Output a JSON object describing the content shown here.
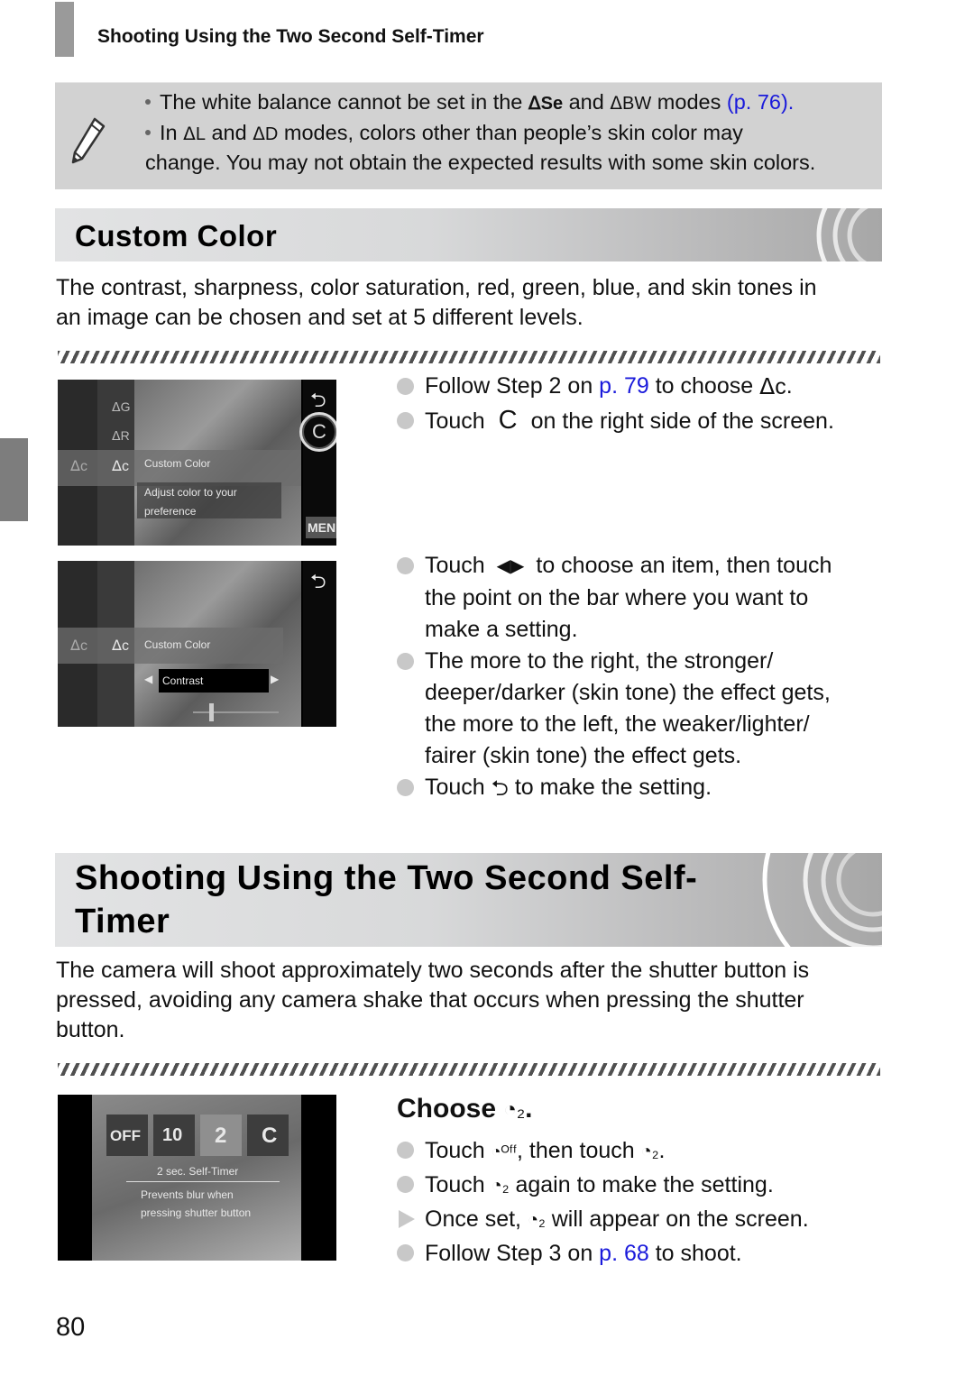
{
  "running_header": {
    "title": "Shooting Using the Two Second Self-Timer"
  },
  "note": {
    "icon": "pencil-icon",
    "line1": {
      "pre": "The white balance cannot be set in the",
      "mode1": "Se",
      "mid": "and",
      "mode2": "BW",
      "post": "modes",
      "link": "(p. 76)",
      "end": "."
    },
    "line2": {
      "pre": "In",
      "mode1": "L",
      "mid": "and",
      "mode2": "D",
      "post": "modes, colors other than people’s skin color may"
    },
    "line3": "change. You may not obtain the expected results with some skin colors."
  },
  "custom_color": {
    "heading": "Custom Color",
    "intro_line1": "The contrast, sharpness, color saturation, red, green, blue, and skin tones in",
    "intro_line2": "an image can be chosen and set at 5 different levels.",
    "screen1": {
      "label_title": "Custom Color",
      "label_desc1": "Adjust color to your",
      "label_desc2": "preference",
      "menu": "MENU",
      "button": "C"
    },
    "screen2": {
      "label_title": "Custom Color",
      "item": "Contrast"
    },
    "steps_a": [
      {
        "pre": "Follow Step 2 on",
        "link": "p. 79",
        "post": "to choose",
        "icon": "custom-color-mode-icon",
        "end": "."
      },
      {
        "pre": "Touch",
        "glyph": "C",
        "post": "on the right side of the screen."
      }
    ],
    "steps_b": [
      {
        "lines": [
          "to choose an item, then touch",
          "the point on the bar where you want to",
          "make a setting."
        ],
        "pre": "Touch"
      },
      {
        "lines": [
          "The more to the right, the stronger/",
          "deeper/darker (skin tone) the effect gets,",
          "the more to the left, the weaker/lighter/",
          "fairer (skin tone) the effect gets."
        ]
      },
      {
        "pre": "Touch",
        "post": "to make the setting."
      }
    ]
  },
  "self_timer": {
    "heading_line1": "Shooting Using the Two Second Self-",
    "heading_line2": "Timer",
    "intro_line1": "The camera will shoot approximately two seconds after the shutter button is",
    "intro_line2": "pressed, avoiding any camera shake that occurs when pressing the shutter",
    "intro_line3": "button.",
    "screen": {
      "options": [
        "OFF",
        "10",
        "2",
        "C"
      ],
      "selected": "2",
      "label_title": "2 sec. Self-Timer",
      "label_desc1": "Prevents blur when",
      "label_desc2": "pressing shutter button"
    },
    "choose_title": "Choose",
    "choose_end": ".",
    "steps": [
      {
        "pre": "Touch",
        "mid": ", then touch",
        "end": "."
      },
      {
        "pre": "Touch",
        "post": "again to make the setting."
      },
      {
        "pre": "Once set,",
        "post": "will appear on the screen."
      },
      {
        "pre": "Follow Step 3 on",
        "link": "p. 68",
        "post": "to shoot."
      }
    ]
  },
  "page_number": "80",
  "colors": {
    "link": "#1a1adb",
    "note_bg": "#d2d2d2",
    "side_tab": "#7d7d7d"
  }
}
